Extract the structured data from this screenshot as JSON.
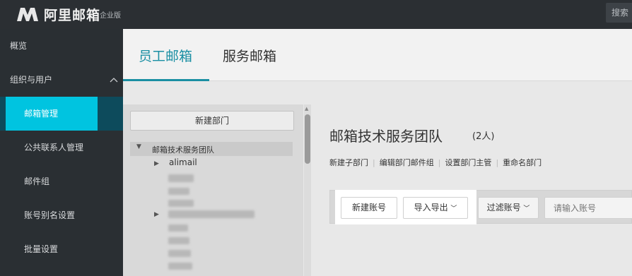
{
  "header": {
    "brand": "阿里邮箱",
    "edition": "企业版",
    "search_label": "搜索"
  },
  "sidebar": {
    "items": [
      {
        "label": "概览"
      },
      {
        "label": "组织与用户"
      },
      {
        "label": "邮箱管理"
      },
      {
        "label": "公共联系人管理"
      },
      {
        "label": "邮件组"
      },
      {
        "label": "账号别名设置"
      },
      {
        "label": "批量设置"
      }
    ]
  },
  "tabs": [
    {
      "label": "员工邮箱"
    },
    {
      "label": "服务邮箱"
    }
  ],
  "tree": {
    "new_dept_label": "新建部门",
    "root_label": "邮箱技术服务团队",
    "child_label": "alimail"
  },
  "dept": {
    "title": "邮箱技术服务团队",
    "count": "(2人)",
    "actions": [
      "新建子部门",
      "编辑部门邮件组",
      "设置部门主管",
      "重命名部门"
    ]
  },
  "toolbar": {
    "new_account": "新建账号",
    "import_export": "导入导出",
    "filter": "过滤账号",
    "search_placeholder": "请输入账号"
  },
  "colors": {
    "accent": "#00c4e0",
    "tab_active": "#1a8fa3",
    "sidebar_bg": "#2a2f33"
  }
}
